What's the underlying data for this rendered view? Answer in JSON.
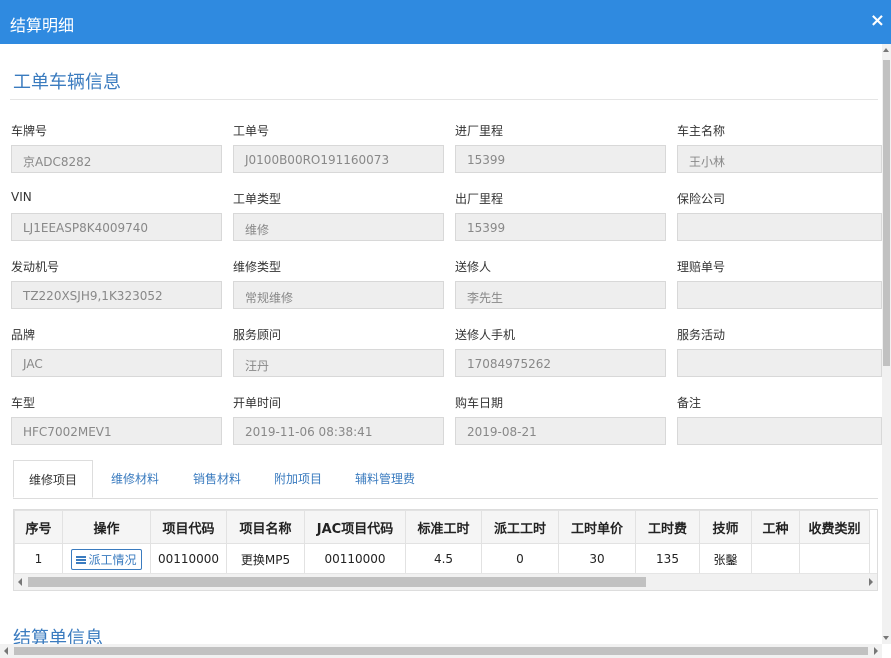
{
  "window": {
    "title": "结算明细",
    "close_glyph": "×"
  },
  "section1": {
    "title": "工单车辆信息"
  },
  "fields": {
    "plate": {
      "label": "车牌号",
      "value": "京ADC8282"
    },
    "order_no": {
      "label": "工单号",
      "value": "J0100B00RO191160073"
    },
    "in_mileage": {
      "label": "进厂里程",
      "value": "15399"
    },
    "owner_name": {
      "label": "车主名称",
      "value": "王小林"
    },
    "vin": {
      "label": "VIN",
      "value": "LJ1EEASP8K4009740"
    },
    "order_type": {
      "label": "工单类型",
      "value": "维修"
    },
    "out_mileage": {
      "label": "出厂里程",
      "value": "15399"
    },
    "insurer": {
      "label": "保险公司",
      "value": ""
    },
    "engine_no": {
      "label": "发动机号",
      "value": "TZ220XSJH9,1K323052"
    },
    "repair_type": {
      "label": "维修类型",
      "value": "常规维修"
    },
    "sender": {
      "label": "送修人",
      "value": "李先生"
    },
    "claim_no": {
      "label": "理赔单号",
      "value": ""
    },
    "brand": {
      "label": "品牌",
      "value": "JAC"
    },
    "advisor": {
      "label": "服务顾问",
      "value": "汪丹"
    },
    "sender_phone": {
      "label": "送修人手机",
      "value": "17084975262"
    },
    "service_activity": {
      "label": "服务活动",
      "value": ""
    },
    "model": {
      "label": "车型",
      "value": "HFC7002MEV1"
    },
    "open_time": {
      "label": "开单时间",
      "value": "2019-11-06 08:38:41"
    },
    "purchase_date": {
      "label": "购车日期",
      "value": "2019-08-21"
    },
    "remark": {
      "label": "备注",
      "value": ""
    }
  },
  "tabs": [
    {
      "label": "维修项目",
      "active": true
    },
    {
      "label": "维修材料"
    },
    {
      "label": "销售材料"
    },
    {
      "label": "附加项目"
    },
    {
      "label": "辅料管理费"
    }
  ],
  "table": {
    "headers": [
      "序号",
      "操作",
      "项目代码",
      "项目名称",
      "JAC项目代码",
      "标准工时",
      "派工工时",
      "工时单价",
      "工时费",
      "技师",
      "工种",
      "收费类别"
    ],
    "rows": [
      {
        "no": "1",
        "action": "派工情况",
        "code": "00110000",
        "name": "更换MP5",
        "jac_code": "00110000",
        "std_hours": "4.5",
        "dispatch_hours": "0",
        "unit_price": "30",
        "fee": "135",
        "technician": "张鑿",
        "work_type": "",
        "charge_type": ""
      }
    ]
  },
  "section2": {
    "title": "结算单信息"
  },
  "colors": {
    "accent": "#2f8ae0",
    "link": "#3a7bbf"
  }
}
